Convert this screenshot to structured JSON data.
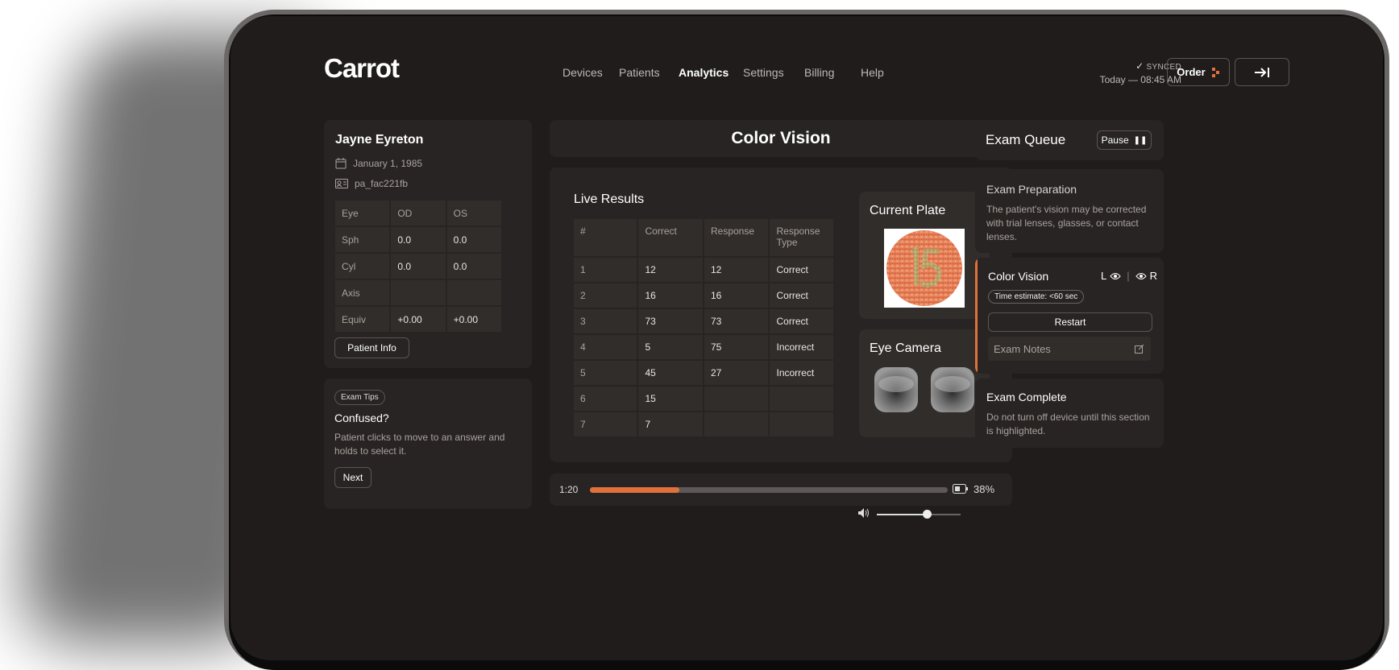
{
  "app": {
    "logo": "Carrot"
  },
  "nav": {
    "items": [
      "Devices",
      "Patients",
      "Analytics",
      "Settings",
      "Billing",
      "Help"
    ],
    "active": "Analytics"
  },
  "sync": {
    "status": "SYNCED",
    "time": "Today — 08:45 AM"
  },
  "header": {
    "order_label": "Order",
    "logout_icon": "logout-arrow-icon"
  },
  "patient": {
    "name": "Jayne Eyreton",
    "dob": "January 1, 1985",
    "id": "pa_fac221fb",
    "table": {
      "headers": [
        "Eye",
        "OD",
        "OS"
      ],
      "rows": [
        [
          "Sph",
          "0.0",
          "0.0"
        ],
        [
          "Cyl",
          "0.0",
          "0.0"
        ],
        [
          "Axis",
          "",
          ""
        ],
        [
          "Equiv",
          "+0.00",
          "+0.00"
        ]
      ]
    },
    "info_button": "Patient Info"
  },
  "tips": {
    "tag": "Exam Tips",
    "title": "Confused?",
    "body": "Patient clicks to move to an answer and holds to select it.",
    "next_button": "Next"
  },
  "exam": {
    "title": "Color Vision"
  },
  "results": {
    "title": "Live Results",
    "headers": [
      "#",
      "Correct",
      "Response",
      "Response Type"
    ],
    "rows": [
      [
        "1",
        "12",
        "12",
        "Correct"
      ],
      [
        "2",
        "16",
        "16",
        "Correct"
      ],
      [
        "3",
        "73",
        "73",
        "Correct"
      ],
      [
        "4",
        "5",
        "75",
        "Incorrect"
      ],
      [
        "5",
        "45",
        "27",
        "Incorrect"
      ],
      [
        "6",
        "15",
        "",
        ""
      ],
      [
        "7",
        "7",
        "",
        ""
      ]
    ]
  },
  "plate": {
    "title": "Current Plate",
    "number": "15"
  },
  "camera": {
    "title": "Eye Camera"
  },
  "player": {
    "time": "1:20",
    "progress": 0.25,
    "battery": "38%",
    "volume": 0.6
  },
  "queue": {
    "title": "Exam Queue",
    "pause_button": "Pause",
    "prep": {
      "title": "Exam Preparation",
      "body": "The patient's vision may be corrected with trial lenses, glasses, or contact lenses."
    },
    "current": {
      "title": "Color Vision",
      "left_eye": "L",
      "right_eye": "R",
      "estimate": "Time estimate: <60 sec",
      "restart": "Restart",
      "notes": "Exam Notes"
    },
    "complete": {
      "title": "Exam Complete",
      "body": "Do not turn off device until this section is highlighted."
    }
  },
  "colors": {
    "accent": "#e0713c",
    "background": "#1f1c1b",
    "card": "#282423"
  }
}
